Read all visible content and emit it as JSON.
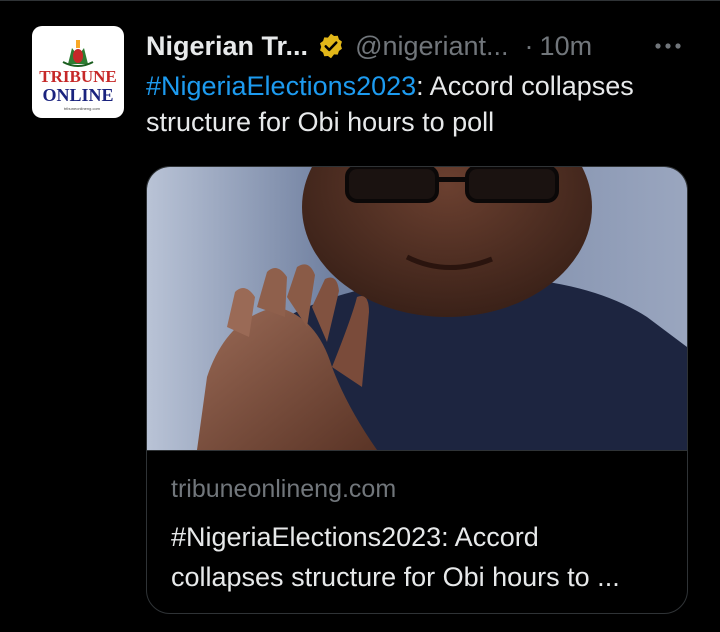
{
  "account": {
    "display_name": "Nigerian Tr...",
    "handle": "@nigeriant...",
    "separator": "·",
    "time": "10m",
    "avatar_brand_line1": "TRIBUNE",
    "avatar_brand_line2": "ONLINE",
    "avatar_site": "tribuneonlineng.com"
  },
  "tweet": {
    "hashtag": "#NigeriaElections2023",
    "text_after_hashtag": ": Accord collapses structure for Obi hours to poll"
  },
  "card": {
    "domain": "tribuneonlineng.com",
    "title_line1": "#NigeriaElections2023: Accord",
    "title_line2": "collapses structure for Obi hours to ..."
  },
  "icons": {
    "verified": "verified-badge-icon",
    "more": "more-icon"
  },
  "colors": {
    "background": "#000000",
    "text": "#e7e9ea",
    "muted": "#71767b",
    "link": "#1d9bf0",
    "verified_gold": "#e2b719",
    "border": "#2f3336"
  }
}
